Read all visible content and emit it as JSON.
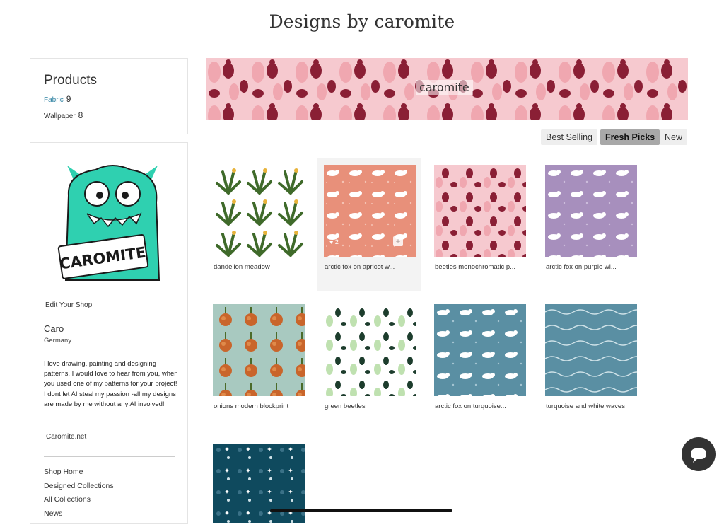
{
  "title": "Designs by caromite",
  "products": {
    "heading": "Products",
    "items": [
      {
        "label": "Fabric",
        "count": "9"
      },
      {
        "label": "Wallpaper",
        "count": "8"
      }
    ]
  },
  "profile": {
    "avatar_text": "CAROMITE",
    "edit_shop": "Edit Your Shop",
    "name": "Caro",
    "country": "Germany",
    "bio": "I love drawing, painting and designing patterns. I would love to hear from you, when you used one of my patterns for your project! I dont let AI steal my passion -all my designs are made by me without any AI involved!",
    "website": "Caromite.net",
    "nav": [
      "Shop Home",
      "Designed Collections",
      "All Collections",
      "News"
    ]
  },
  "banner": {
    "label": "caromite"
  },
  "sort": {
    "best_selling": "Best Selling",
    "fresh_picks": "Fresh Picks",
    "new": "New"
  },
  "designs": [
    {
      "label": "dandelion meadow",
      "icon": "dandelion-pattern"
    },
    {
      "label": "arctic fox on apricot w...",
      "icon": "fox-pattern",
      "likes": "2"
    },
    {
      "label": "beetles monochromatic p...",
      "icon": "beetle-pattern"
    },
    {
      "label": "arctic fox on purple wi...",
      "icon": "fox-pattern"
    },
    {
      "label": "onions modern blockprint",
      "icon": "onion-pattern"
    },
    {
      "label": "green beetles",
      "icon": "beetle-pattern"
    },
    {
      "label": "arctic fox on turquoise...",
      "icon": "fox-pattern"
    },
    {
      "label": "turquoise and white waves",
      "icon": "wave-pattern"
    },
    {
      "label": "",
      "icon": "star-pattern"
    }
  ],
  "colors": {
    "accent_link": "#2a7fa0",
    "banner_bg": "#f6c9cf",
    "beetle": "#8a1f35",
    "apricot": "#e8907a",
    "purple": "#a78fbd",
    "turquoise": "#5a8fa3",
    "navy": "#0f4a5e",
    "onion_bg": "#a8c9c0"
  }
}
